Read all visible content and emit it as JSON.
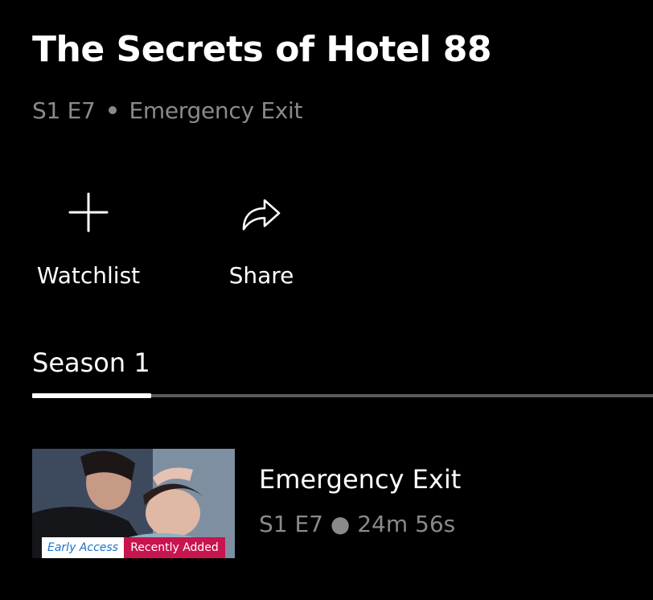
{
  "show": {
    "title": "The Secrets of Hotel 88",
    "current_episode_code": "S1 E7",
    "current_episode_name": "Emergency Exit"
  },
  "actions": {
    "watchlist_label": "Watchlist",
    "watchlist_icon": "plus-icon",
    "share_label": "Share",
    "share_icon": "share-arrow-icon"
  },
  "seasons": {
    "tabs": [
      {
        "label": "Season 1",
        "selected": true
      }
    ]
  },
  "episodes": [
    {
      "title": "Emergency Exit",
      "code": "S1 E7",
      "duration": "24m 56s",
      "badges": {
        "early_access": "Early Access",
        "recently_added": "Recently Added"
      }
    }
  ],
  "colors": {
    "background": "#000000",
    "text_primary": "#ffffff",
    "text_secondary": "#8a8a8a",
    "tab_track": "#5a5a5a",
    "early_access_text": "#1a73c9",
    "recently_added_bg": "#c8144f"
  }
}
